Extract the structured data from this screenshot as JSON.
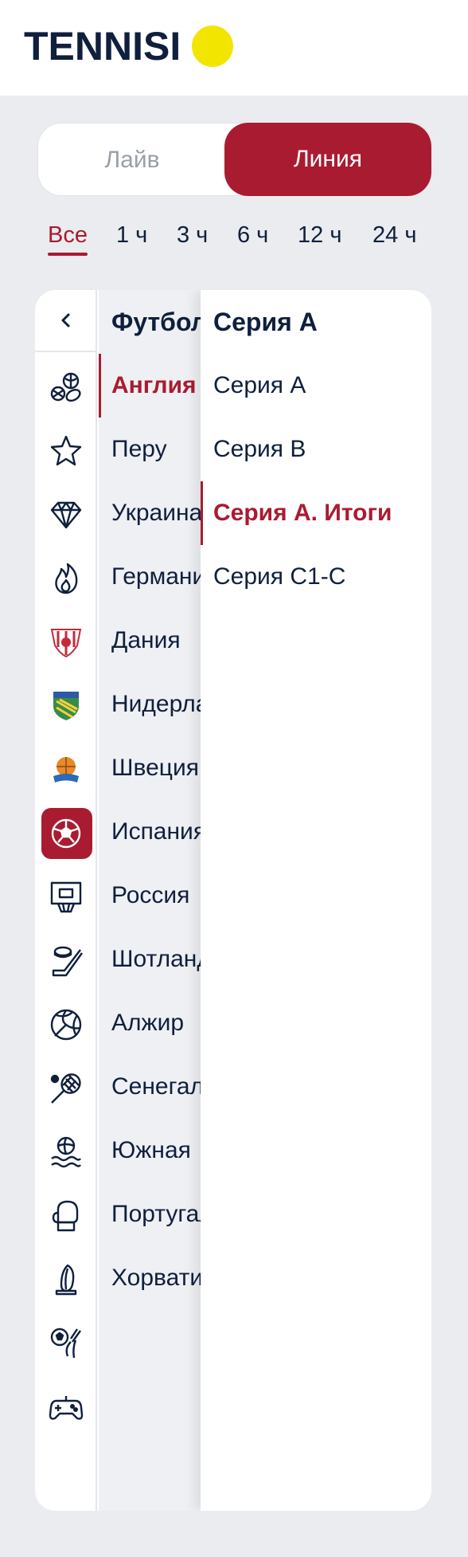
{
  "header": {
    "logo_text": "TENNISI"
  },
  "mode_toggle": {
    "live_label": "Лайв",
    "line_label": "Линия",
    "active": "line"
  },
  "time_filter": {
    "items": [
      {
        "label": "Все",
        "active": true
      },
      {
        "label": "1 ч"
      },
      {
        "label": "3 ч"
      },
      {
        "label": "6 ч"
      },
      {
        "label": "12 ч"
      },
      {
        "label": "24 ч"
      }
    ]
  },
  "rail": {
    "items": [
      {
        "icon": "multisport-icon"
      },
      {
        "icon": "star-icon"
      },
      {
        "icon": "diamond-icon"
      },
      {
        "icon": "fire-icon"
      },
      {
        "icon": "club-crest-red-icon"
      },
      {
        "icon": "club-crest-green-icon"
      },
      {
        "icon": "club-crest-basket-icon"
      },
      {
        "icon": "football-icon",
        "active": true
      },
      {
        "icon": "basketball-hoop-icon"
      },
      {
        "icon": "hockey-icon"
      },
      {
        "icon": "volleyball-icon"
      },
      {
        "icon": "tennis-icon"
      },
      {
        "icon": "water-polo-icon"
      },
      {
        "icon": "boxing-glove-icon"
      },
      {
        "icon": "surfboard-icon"
      },
      {
        "icon": "football-hand-icon"
      },
      {
        "icon": "gamepad-icon"
      }
    ]
  },
  "countries": {
    "title": "Футбол",
    "items": [
      {
        "label": "Англия",
        "active": true
      },
      {
        "label": "Перу"
      },
      {
        "label": "Украина"
      },
      {
        "label": "Германия"
      },
      {
        "label": "Дания"
      },
      {
        "label": "Нидерланды"
      },
      {
        "label": "Швеция"
      },
      {
        "label": "Испания"
      },
      {
        "label": "Россия"
      },
      {
        "label": "Шотландия"
      },
      {
        "label": "Алжир"
      },
      {
        "label": "Сенегал"
      },
      {
        "label": "Южная"
      },
      {
        "label": "Португалия"
      },
      {
        "label": "Хорватия"
      }
    ]
  },
  "leagues": {
    "title": "Серия А",
    "items": [
      {
        "label": "Серия А"
      },
      {
        "label": "Серия B"
      },
      {
        "label": "Серия А. Итоги",
        "active": true
      },
      {
        "label": "Серия С1-С"
      }
    ]
  },
  "colors": {
    "brand_red": "#a91b31",
    "navy": "#0f1f3d",
    "logo_yellow": "#f2e600",
    "page_bg": "#ebecef"
  }
}
